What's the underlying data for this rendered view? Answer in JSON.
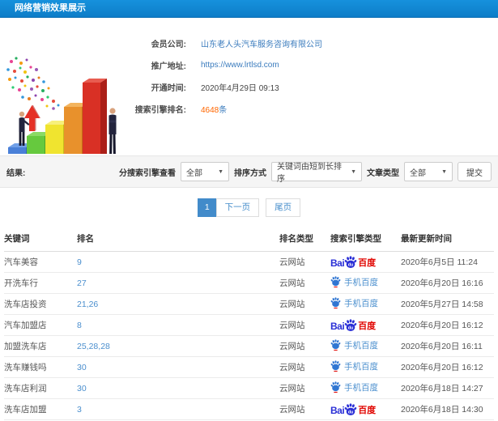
{
  "header": {
    "title": "网络营销效果展示"
  },
  "info": {
    "rows": [
      {
        "label": "会员公司:",
        "value": "山东老人头汽车服务咨询有限公司"
      },
      {
        "label": "推广地址:",
        "value": "https://www.lrtlsd.com"
      },
      {
        "label": "开通时间:",
        "value": "2020年4月29日 09:13"
      },
      {
        "label": "搜索引擎排名:",
        "count": "4648",
        "unit": "条"
      }
    ]
  },
  "filters": {
    "result_label": "结果:",
    "engine_label": "分搜索引擎查看",
    "engine_value": "全部",
    "sort_label": "排序方式",
    "sort_value": "关键词由短到长排序",
    "article_label": "文章类型",
    "article_value": "全部",
    "submit_label": "提交"
  },
  "pagination": {
    "current": "1",
    "next": "下一页",
    "last": "尾页"
  },
  "table": {
    "headers": [
      "关键词",
      "排名",
      "排名类型",
      "搜索引擎类型",
      "最新更新时间"
    ],
    "engine_labels": {
      "baidu_bai": "Bai",
      "baidu_du": "du",
      "baidu_cn": "百度",
      "mobile_baidu": "手机百度"
    },
    "rows": [
      {
        "keyword": "汽车美容",
        "rank": "9",
        "rank_type": "云网站",
        "engine": "baidu",
        "time": "2020年6月5日 11:24"
      },
      {
        "keyword": "开洗车行",
        "rank": "27",
        "rank_type": "云网站",
        "engine": "mobile-baidu",
        "time": "2020年6月20日 16:16"
      },
      {
        "keyword": "洗车店投资",
        "rank": "21,26",
        "rank_type": "云网站",
        "engine": "mobile-baidu",
        "time": "2020年5月27日 14:58"
      },
      {
        "keyword": "汽车加盟店",
        "rank": "8",
        "rank_type": "云网站",
        "engine": "baidu",
        "time": "2020年6月20日 16:12"
      },
      {
        "keyword": "加盟洗车店",
        "rank": "25,28,28",
        "rank_type": "云网站",
        "engine": "mobile-baidu",
        "time": "2020年6月20日 16:11"
      },
      {
        "keyword": "洗车赚钱吗",
        "rank": "30",
        "rank_type": "云网站",
        "engine": "mobile-baidu",
        "time": "2020年6月20日 16:12"
      },
      {
        "keyword": "洗车店利润",
        "rank": "30",
        "rank_type": "云网站",
        "engine": "mobile-baidu",
        "time": "2020年6月18日 14:27"
      },
      {
        "keyword": "洗车店加盟",
        "rank": "3",
        "rank_type": "云网站",
        "engine": "baidu",
        "time": "2020年6月18日 14:30"
      }
    ]
  },
  "colors": {
    "header_blue": "#1287d3",
    "link_blue": "#3a7bbd",
    "rank_blue": "#4b8fce",
    "count_orange": "#ff6600",
    "pager_active": "#428bca",
    "baidu_blue": "#2a2fd6",
    "baidu_red": "#e10500"
  }
}
